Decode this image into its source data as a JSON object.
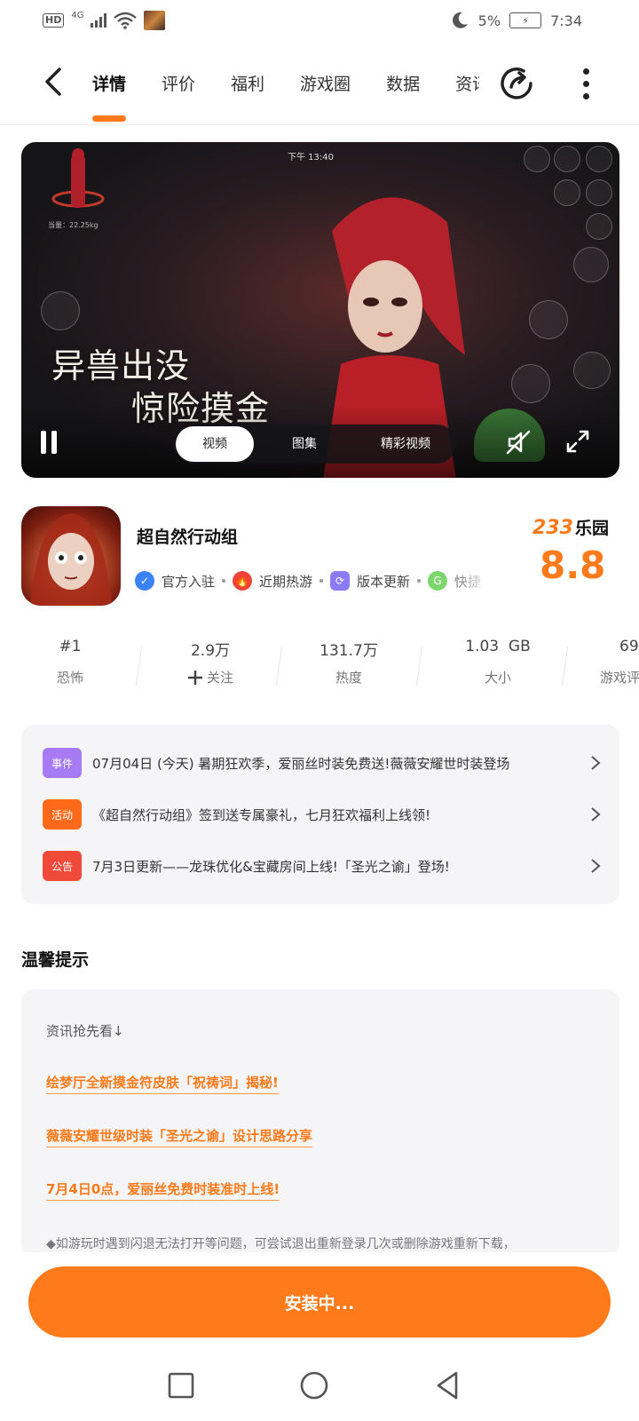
{
  "status_bar": {
    "hd": "HD",
    "network": "4G",
    "battery_percent": "5%",
    "time": "7:34"
  },
  "nav": {
    "tabs": [
      {
        "label": "详情",
        "active": true
      },
      {
        "label": "评价",
        "active": false
      },
      {
        "label": "福利",
        "active": false
      },
      {
        "label": "游戏圈",
        "active": false
      },
      {
        "label": "数据",
        "active": false
      },
      {
        "label": "资讯",
        "active": false
      }
    ],
    "icons": {
      "back": "back-arrow-icon",
      "share": "share-icon",
      "more": "more-vertical-icon"
    }
  },
  "video": {
    "hud_time": "下午 13:40",
    "hud_weight": "当量：22.25kg",
    "overlay_line1": "异兽出没",
    "overlay_line2": "惊险摸金",
    "media_tabs": [
      "视频",
      "图集",
      "精彩视频"
    ],
    "active_media_tab": 0
  },
  "app": {
    "name": "超自然行动组",
    "tags": [
      "官方入驻",
      "近期热游",
      "版本更新",
      "快捷"
    ],
    "rating_brand_number": "233",
    "rating_brand_text": "乐园",
    "rating_score": "8.8"
  },
  "stats": [
    {
      "value": "#1",
      "label": "恐怖"
    },
    {
      "value": "2.9万",
      "label": "关注",
      "has_plus": true
    },
    {
      "value": "131.7万",
      "label": "热度"
    },
    {
      "value": "1.03  GB",
      "label": "大小"
    },
    {
      "value": "69",
      "label": "游戏评"
    }
  ],
  "notices": [
    {
      "badge": "事件",
      "color": "#a77bf3",
      "text": "07月04日  (今天)  暑期狂欢季，爱丽丝时装免费送!薇薇安耀世时装登场"
    },
    {
      "badge": "活动",
      "color": "#ff6a1a",
      "text": "《超自然行动组》签到送专属豪礼，七月狂欢福利上线领!"
    },
    {
      "badge": "公告",
      "color": "#f04a3a",
      "text": "7月3日更新——龙珠优化&宝藏房间上线!「圣光之谕」登场!"
    }
  ],
  "tips": {
    "title": "温馨提示",
    "header": "资讯抢先看↓",
    "links": [
      "绘梦厅全新摸金符皮肤「祝祷词」揭秘!",
      "薇薇安耀世级时装「圣光之谕」设计思路分享",
      "7月4日0点，爱丽丝免费时装准时上线!"
    ],
    "note": "◆如游玩时遇到闪退无法打开等问题，可尝试退出重新登录几次或删除游戏重新下载，"
  },
  "install_button": "安装中...",
  "colors": {
    "accent": "#ff7a1a",
    "card_bg": "#f5f5f7"
  }
}
